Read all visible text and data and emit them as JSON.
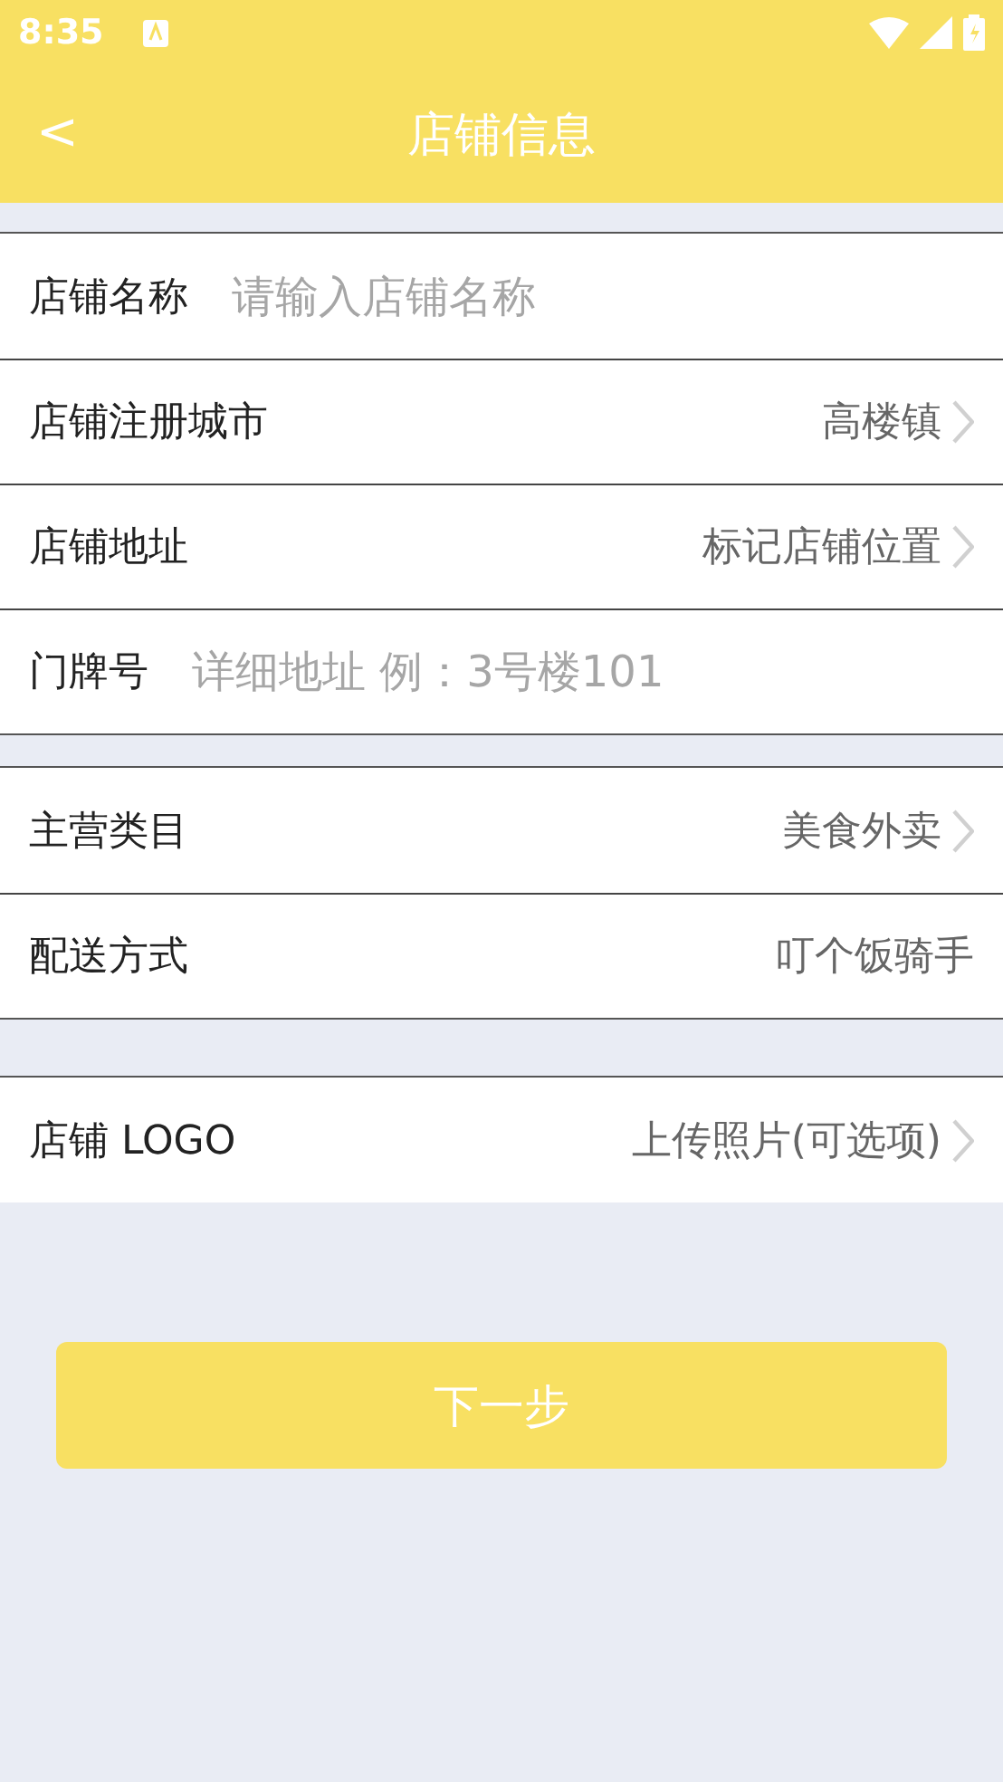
{
  "status_bar": {
    "time": "8:35"
  },
  "header": {
    "back": "<",
    "title": "店铺信息"
  },
  "groups": [
    {
      "rows": [
        {
          "kind": "input",
          "label": "店铺名称",
          "placeholder": "请输入店铺名称"
        },
        {
          "kind": "select",
          "label": "店铺注册城市",
          "value": "高楼镇"
        },
        {
          "kind": "select",
          "label": "店铺地址",
          "value": "标记店铺位置"
        },
        {
          "kind": "input",
          "label": "门牌号",
          "placeholder": "详细地址 例：3号楼101"
        }
      ]
    },
    {
      "rows": [
        {
          "kind": "select",
          "label": "主营类目",
          "value": "美食外卖"
        },
        {
          "kind": "text",
          "label": "配送方式",
          "value": "叮个饭骑手"
        }
      ]
    },
    {
      "rows": [
        {
          "kind": "select",
          "label": "店铺 LOGO",
          "value": "上传照片(可选项)"
        }
      ]
    }
  ],
  "next_button": "下一步"
}
